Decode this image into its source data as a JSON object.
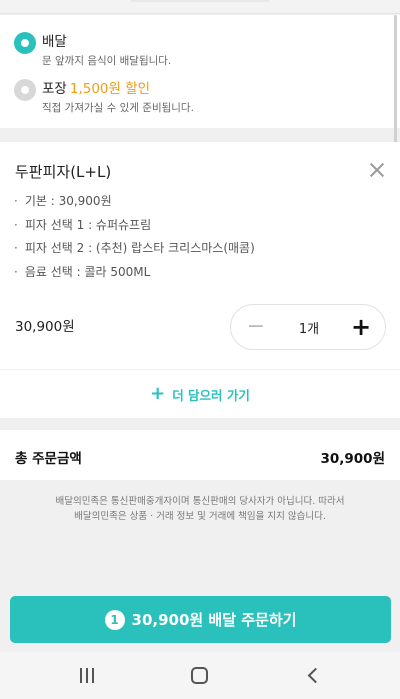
{
  "delivery_options": [
    {
      "title": "배달",
      "desc": "문 앞까지 음식이 배달됩니다.",
      "selected": true
    },
    {
      "title": "포장",
      "discount": "1,500원 할인",
      "desc": "직접 가져가실 수 있게 준비됩니다.",
      "selected": false
    }
  ],
  "order_item": {
    "name": "두판피자(L+L)",
    "options": [
      "기본 : 30,900원",
      "피자 선택 1 : 슈퍼슈프림",
      "피자 선택 2 : (추천) 랍스타 크리스마스(매콤)",
      "음료 선택 : 콜라 500ML"
    ],
    "price": "30,900원",
    "quantity": "1개"
  },
  "add_more_label": "더 담으러 가기",
  "total": {
    "label": "총 주문금액",
    "value": "30,900원"
  },
  "notice_lines": [
    "배달의민족은 통신판매중개자이며 통신판매의 당사자가 아닙니다. 따라서",
    "배달의민족은 상품 · 거래 정보 및 거래에 책임을 지지 않습니다."
  ],
  "order_button": {
    "count": "1",
    "label": "30,900원 배달 주문하기"
  },
  "colors": {
    "accent": "#2ac1bc",
    "discount": "#f39c12"
  }
}
